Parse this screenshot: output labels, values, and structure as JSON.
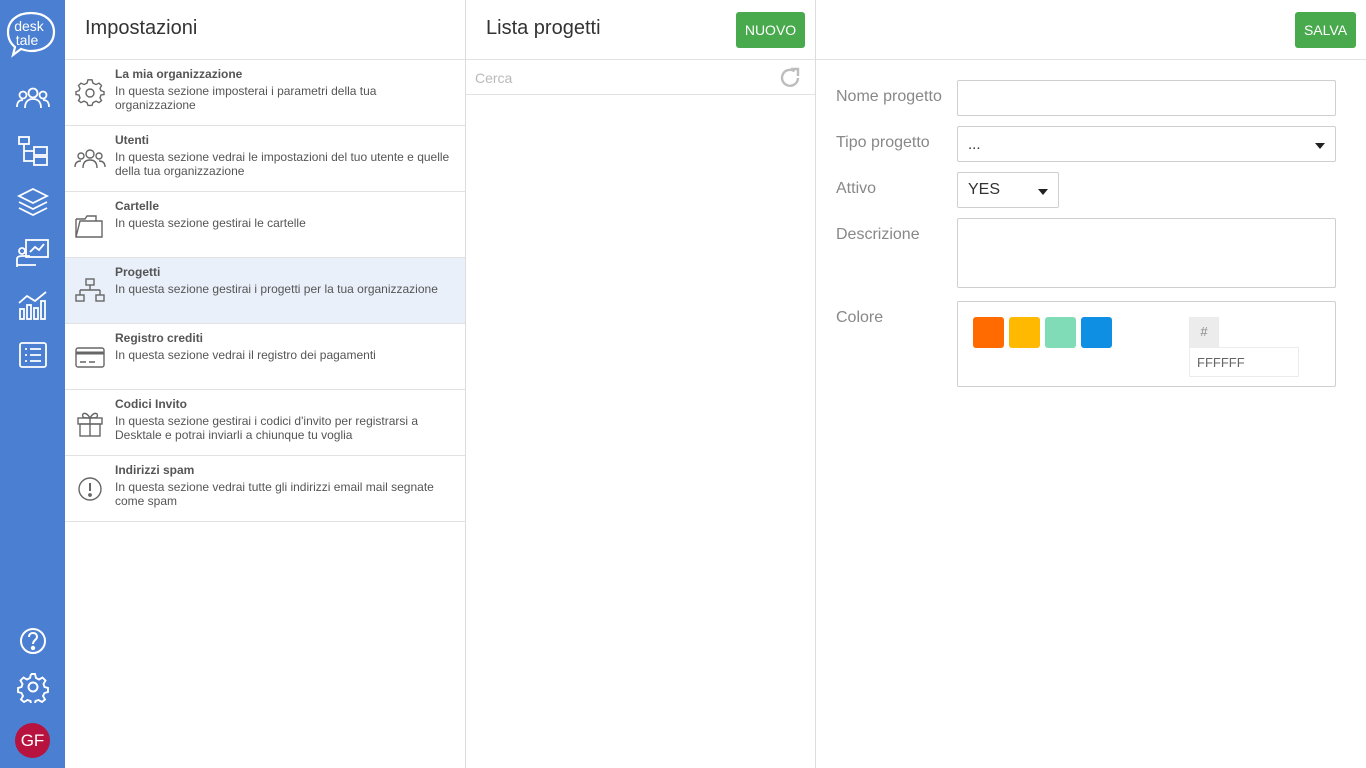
{
  "rail": {
    "logo_top": "desk",
    "logo_bottom": "tale",
    "icons": [
      "users-icon",
      "folder-tree-icon",
      "layers-icon",
      "presentation-icon",
      "analytics-icon",
      "list-icon",
      "help-icon",
      "gear-icon"
    ],
    "avatar_initials": "GF",
    "avatar_color": "#b8123f"
  },
  "settings": {
    "title": "Impostazioni",
    "items": [
      {
        "title": "La mia organizzazione",
        "desc": "In questa sezione imposterai i parametri della tua organizzazione",
        "icon": "gear-icon"
      },
      {
        "title": "Utenti",
        "desc": "In questa sezione vedrai le impostazioni del tuo utente e quelle della tua organizzazione",
        "icon": "users-icon"
      },
      {
        "title": "Cartelle",
        "desc": "In questa sezione gestirai le cartelle",
        "icon": "folder-icon"
      },
      {
        "title": "Progetti",
        "desc": "In questa sezione gestirai i progetti per la tua organizzazione",
        "icon": "sitemap-icon",
        "active": true
      },
      {
        "title": "Registro crediti",
        "desc": "In questa sezione vedrai il registro dei pagamenti",
        "icon": "credit-card-icon"
      },
      {
        "title": "Codici Invito",
        "desc": "In questa sezione gestirai i codici d'invito per registrarsi a Desktale e potrai inviarli a chiunque tu voglia",
        "icon": "gift-icon"
      },
      {
        "title": "Indirizzi spam",
        "desc": "In questa sezione vedrai tutte gli indirizzi email mail segnate come spam",
        "icon": "alert-circle-icon"
      }
    ]
  },
  "projects": {
    "title": "Lista progetti",
    "new_label": "NUOVO",
    "search_placeholder": "Cerca",
    "search_value": ""
  },
  "detail": {
    "save_label": "SALVA",
    "name_label": "Nome progetto",
    "name_value": "",
    "type_label": "Tipo progetto",
    "type_value": "...",
    "active_label": "Attivo",
    "active_value": "YES",
    "description_label": "Descrizione",
    "description_value": "",
    "color_label": "Colore",
    "swatches": [
      "#ff6b00",
      "#ffb900",
      "#7fdcb6",
      "#0e8fe3"
    ],
    "hash_symbol": "#",
    "hex_value": "FFFFFF"
  },
  "colors": {
    "rail": "#4a7fd1",
    "accent_green": "#48a94d",
    "active_row": "#eaf0fa"
  }
}
